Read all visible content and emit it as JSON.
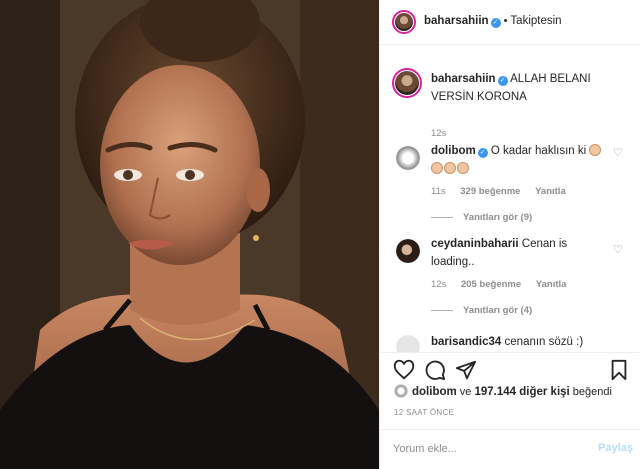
{
  "post": {
    "owner": {
      "username": "baharsahiin",
      "follow_state": "Takiptesin",
      "separator": "•"
    },
    "caption": {
      "username": "baharsahiin",
      "text": "ALLAH BELANI VERSİN KORONA",
      "age": "12s"
    },
    "comments": [
      {
        "username": "dolibom",
        "verified": true,
        "text": "O kadar haklısın ki",
        "age": "11s",
        "likes": "329 beğenme",
        "reply_label": "Yanıtla",
        "view_replies": "Yanıtları gör (9)"
      },
      {
        "username": "ceydaninbaharii",
        "verified": false,
        "text": "Cenan is loading..",
        "age": "12s",
        "likes": "205 beğenme",
        "reply_label": "Yanıtla",
        "view_replies": "Yanıtları gör (4)"
      },
      {
        "username": "barisandic34",
        "verified": false,
        "text": "cenanın sözü :)"
      }
    ],
    "likes_summary": {
      "first_user": "dolibom",
      "connector": "ve",
      "others": "197.144 diğer kişi",
      "suffix": "beğendi"
    },
    "timestamp": "12 SAAT ÖNCE",
    "comment_placeholder": "Yorum ekle...",
    "post_button": "Paylaş"
  },
  "icons": {
    "like": "heart-icon",
    "comment": "comment-icon",
    "share": "share-icon",
    "save": "bookmark-icon",
    "verified": "verified-badge-icon",
    "comment_like": "heart-outline-icon"
  },
  "colors": {
    "verified": "#3897f0",
    "story_ring": "#d6249f",
    "secondary_text": "#8e8e8e",
    "post_button_disabled": "#b2dffc"
  }
}
